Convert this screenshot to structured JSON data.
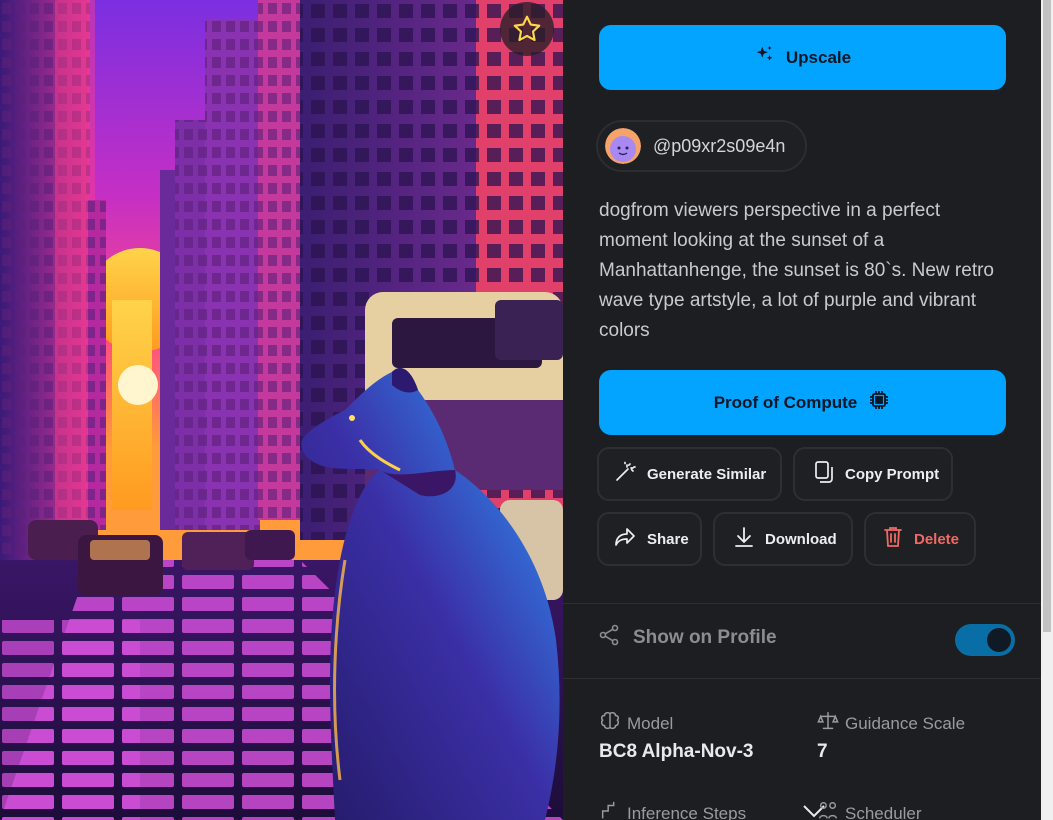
{
  "actions": {
    "upscale_label": "Upscale",
    "proof_label": "Proof of Compute",
    "generate_similar_label": "Generate Similar",
    "copy_prompt_label": "Copy Prompt",
    "share_label": "Share",
    "download_label": "Download",
    "delete_label": "Delete"
  },
  "user": {
    "handle": "@p09xr2s09e4n"
  },
  "prompt": "dogfrom viewers perspective in a perfect moment looking at the sunset of a Manhattanhenge, the sunset is 80`s. New retro wave type artstyle, a lot of purple and vibrant colors",
  "profile": {
    "show_label": "Show on Profile",
    "show_enabled": true
  },
  "details": {
    "model_label": "Model",
    "model_value": "BC8 Alpha-Nov-3",
    "guidance_label": "Guidance Scale",
    "guidance_value": "7",
    "inference_label": "Inference Steps",
    "scheduler_label": "Scheduler"
  },
  "colors": {
    "primary": "#02a4ff",
    "danger": "#f06a64",
    "panel_bg": "#1d1e21",
    "toggle_on": "#0a6ea6"
  },
  "icons": {
    "favorite": "star-icon",
    "upscale": "sparkles-icon",
    "proof": "chip-icon",
    "generate": "magic-wand-icon",
    "copy": "copy-icon",
    "share": "share-icon",
    "download": "download-icon",
    "delete": "trash-icon"
  }
}
